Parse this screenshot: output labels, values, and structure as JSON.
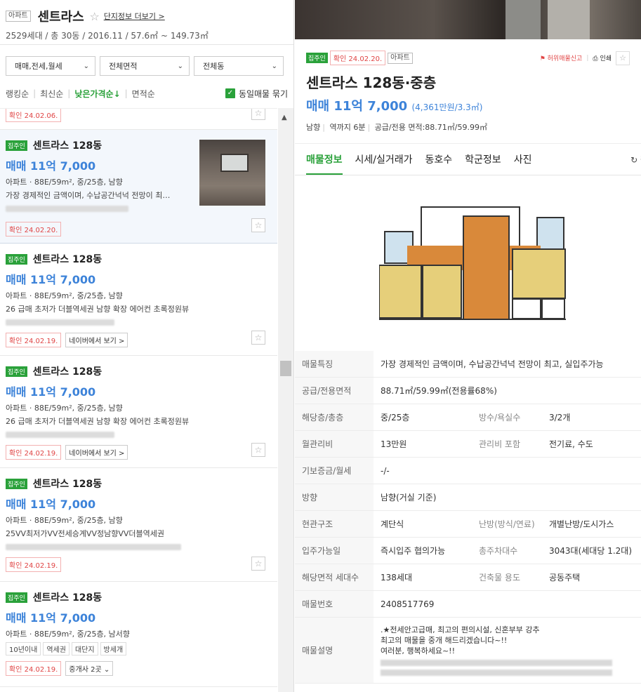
{
  "complex": {
    "type_tag": "아파트",
    "name": "센트라스",
    "star": "☆",
    "info_link": "단지정보 더보기 >",
    "summary": "2529세대 / 총 30동 / 2016.11 / 57.6㎡ ~ 149.73㎡"
  },
  "filters": {
    "trade": "매매,전세,월세",
    "area": "전체면적",
    "building": "전체동",
    "chevron": "⌄"
  },
  "sort": {
    "ranking": "랭킹순",
    "recent": "최신순",
    "low_price": "낮은가격순↓",
    "area": "면적순",
    "group_label": "동일매물 묶기",
    "group_checked": true
  },
  "partial_top_confirm": "확인 24.02.06.",
  "listings": [
    {
      "badge": "집주인",
      "title": "센트라스 128동",
      "price": "매매 11억 7,000",
      "spec": "아파트 · 88E/59m², 중/25층, 남향",
      "desc": "가장 경제적인 금액이며, 수납공간넉넉 전망이 최…",
      "confirm": "확인 24.02.20.",
      "naver": "",
      "has_photo": true
    },
    {
      "badge": "집주인",
      "title": "센트라스 128동",
      "price": "매매 11억 7,000",
      "spec": "아파트 · 88E/59m², 중/25층, 남향",
      "desc": "26 급매 초저가 더블역세권 남향 확장 에어컨 초록정원뷰",
      "confirm": "확인 24.02.19.",
      "naver": "네이버에서 보기 >",
      "has_photo": false
    },
    {
      "badge": "집주인",
      "title": "센트라스 128동",
      "price": "매매 11억 7,000",
      "spec": "아파트 · 88E/59m², 중/25층, 남향",
      "desc": "26 급매 초저가 더블역세권 남향 확장 에어컨 초록정원뷰",
      "confirm": "확인 24.02.19.",
      "naver": "네이버에서 보기 >",
      "has_photo": false
    },
    {
      "badge": "집주인",
      "title": "센트라스 128동",
      "price": "매매 11억 7,000",
      "spec": "아파트 · 88E/59m², 중/25층, 남향",
      "desc": "25VV최저가VV전세승계VV정남향VV더블역세권",
      "confirm": "확인 24.02.19.",
      "naver": "",
      "has_photo": false
    },
    {
      "badge": "집주인",
      "title": "센트라스 128동",
      "price": "매매 11억 7,000",
      "spec": "아파트 · 88E/59m², 중/25층, 남서향",
      "tags": [
        "10년이내",
        "역세권",
        "대단지",
        "방세개"
      ],
      "confirm": "확인 24.02.19.",
      "agents": "중개사 2곳 ⌄",
      "has_photo": false
    }
  ],
  "detail": {
    "badge": "집주인",
    "confirm": "확인 24.02.20.",
    "type_tag": "아파트",
    "report": "허위매물신고",
    "print": "인쇄",
    "title": "센트라스 128동·중층",
    "price": "매매 11억 7,000",
    "price_per": "(4,361만원/3.3㎡)",
    "spec_dir": "남향",
    "spec_station": "역까지 6분",
    "spec_area": "공급/전용 면적:88.71㎡/59.99㎡",
    "tabs": [
      "매물정보",
      "시세/실거래가",
      "동호수",
      "학군정보",
      "사진"
    ],
    "refresh": "↻ 펼"
  },
  "table": {
    "feature_k": "매물특징",
    "feature_v": "가장 경제적인 금액이며, 수납공간넉넉 전망이 최고, 실입주가능",
    "area_k": "공급/전용면적",
    "area_v": "88.71㎡/59.99㎡(전용률68%)",
    "floor_k": "해당층/총층",
    "floor_v": "중/25층",
    "rooms_k": "방수/욕실수",
    "rooms_v": "3/2개",
    "fee_k": "월관리비",
    "fee_v": "13만원",
    "fee_inc_k": "관리비 포함",
    "fee_inc_v": "전기료, 수도",
    "deposit_k": "기보증금/월세",
    "deposit_v": "-/-",
    "dir_k": "방향",
    "dir_v": "남향(거실 기준)",
    "struct_k": "현관구조",
    "struct_v": "계단식",
    "heat_k": "난방(방식/연료)",
    "heat_v": "개별난방/도시가스",
    "movein_k": "입주가능일",
    "movein_v": "즉시입주 협의가능",
    "parking_k": "총주차대수",
    "parking_v": "3043대(세대당 1.2대)",
    "units_k": "해당면적 세대수",
    "units_v": "138세대",
    "use_k": "건축물 용도",
    "use_v": "공동주택",
    "no_k": "매물번호",
    "no_v": "2408517769",
    "desc_k": "매물설명",
    "desc_l1": ".★전세안고급매, 최고의 편의시설, 신혼부부 강추",
    "desc_l2": "최고의 매물을 중개 해드리겠습니다~!!",
    "desc_l3": "여러분, 행복하세요~!!"
  }
}
